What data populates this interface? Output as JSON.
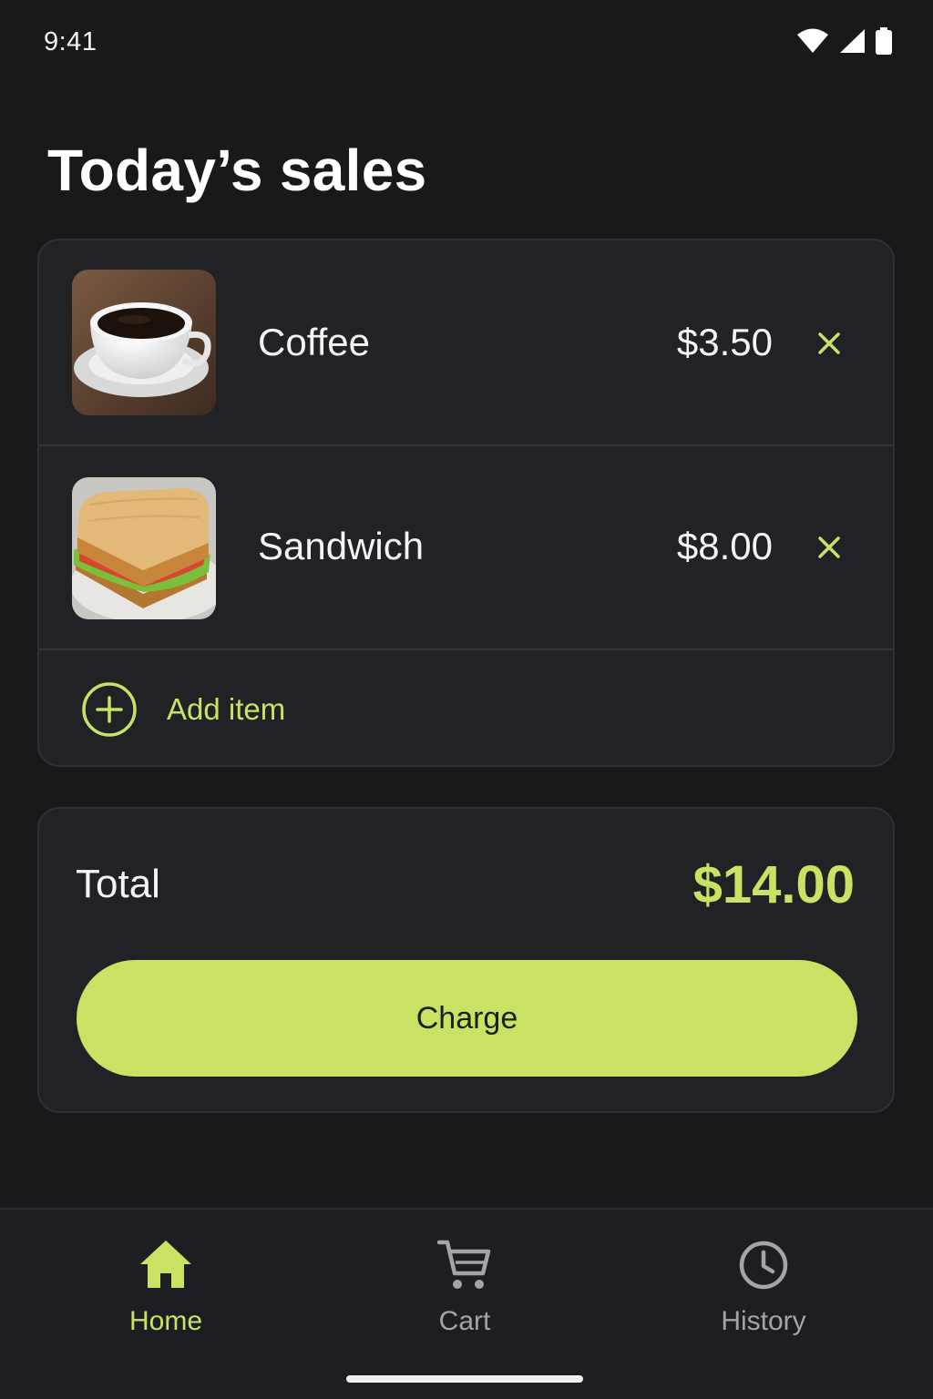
{
  "status_bar": {
    "time": "9:41",
    "icons": [
      "wifi-icon",
      "cellular-signal-icon",
      "battery-icon"
    ]
  },
  "page": {
    "title": "Today’s sales"
  },
  "items": [
    {
      "name": "Coffee",
      "price": "$3.50",
      "thumbnail": "coffee-cup-image",
      "remove_icon": "close-icon"
    },
    {
      "name": "Sandwich",
      "price": "$8.00",
      "thumbnail": "sandwich-image",
      "remove_icon": "close-icon"
    }
  ],
  "add_item": {
    "label": "Add item",
    "icon": "plus-circle-icon"
  },
  "summary": {
    "total_label": "Total",
    "total_value": "$14.00",
    "charge_label": "Charge"
  },
  "bottom_nav": {
    "items": [
      {
        "label": "Home",
        "icon": "home-icon",
        "active": true
      },
      {
        "label": "Cart",
        "icon": "cart-icon",
        "active": false
      },
      {
        "label": "History",
        "icon": "clock-icon",
        "active": false
      }
    ]
  },
  "colors": {
    "background": "#18191b",
    "card": "#212226",
    "accent": "#c8e264",
    "text": "#f4f4f4",
    "muted": "#a3a4a8"
  }
}
